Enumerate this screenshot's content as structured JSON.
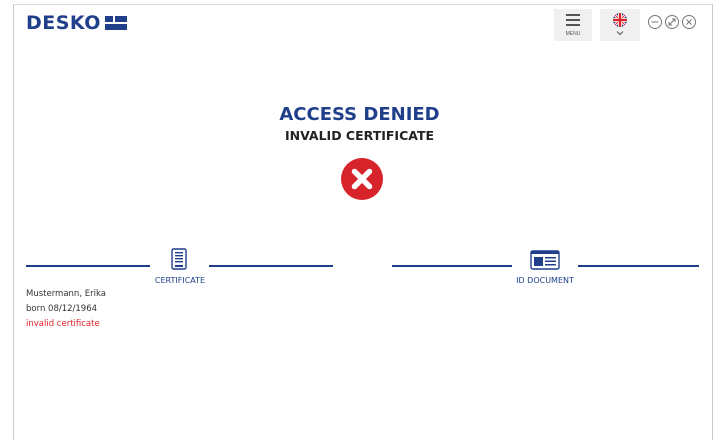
{
  "header": {
    "logo_text": "DESKO",
    "menu_label": "MENU",
    "language_flag": "uk-flag-icon",
    "window_controls": [
      "minimize-icon",
      "resize-icon",
      "close-icon"
    ]
  },
  "status": {
    "title": "ACCESS DENIED",
    "subtitle": "INVALID CERTIFICATE",
    "icon": "error-x-icon"
  },
  "sections": {
    "certificate": {
      "label": "CERTIFICATE",
      "icon": "certificate-document-icon"
    },
    "id_document": {
      "label": "ID DOCUMENT",
      "icon": "id-card-icon"
    }
  },
  "holder": {
    "name": "Mustermann, Erika",
    "born": "born 08/12/1964",
    "error": "invalid certificate"
  },
  "colors": {
    "brand_blue": "#1f3f8b",
    "error_red": "#d7232a",
    "error_text": "#e3242b"
  }
}
